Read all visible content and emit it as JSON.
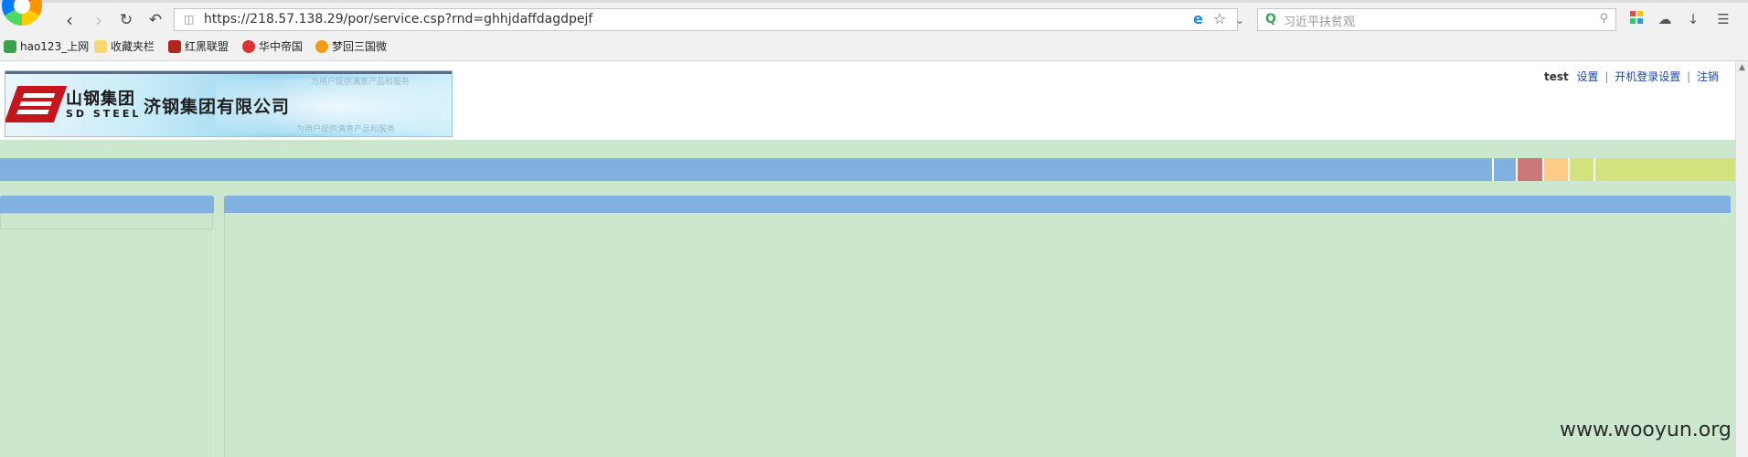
{
  "browser": {
    "url": "https://218.57.138.29/por/service.csp?rnd=ghhjdaffdagdpejf",
    "search_placeholder": "习近平扶贫观",
    "bookmarks": [
      {
        "label": "hao123_上网"
      },
      {
        "label": "收藏夹栏"
      },
      {
        "label": "红黑联盟"
      },
      {
        "label": "华中帝国"
      },
      {
        "label": "梦回三国微"
      }
    ]
  },
  "header": {
    "brand_cn": "山钢集团",
    "brand_en": "SD STEEL",
    "company": "济钢集团有限公司",
    "banner_faint_top": "为用户提供满意产品和服务",
    "banner_faint_bottom": "为用户提供满意产品和服务",
    "user": "test",
    "links": [
      {
        "label": "设置"
      },
      {
        "label": "开机登录设置"
      },
      {
        "label": "注销"
      }
    ]
  },
  "menubar": {
    "colors": {
      "bar": "#81b1e1",
      "block_red": "#c97a78",
      "block_orange": "#ffcc88",
      "block_green": "#d2e37e"
    }
  },
  "watermark": "www.wooyun.org"
}
